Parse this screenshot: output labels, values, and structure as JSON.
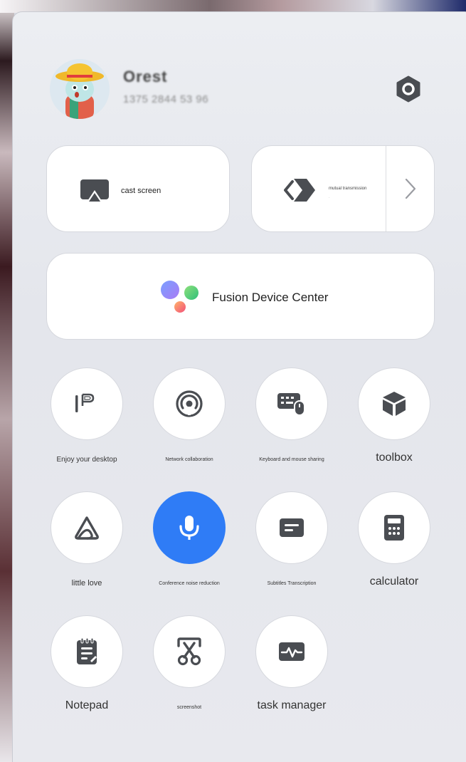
{
  "user": {
    "name": "Orest",
    "id": "1375 2844 53 96"
  },
  "cards": {
    "cast": {
      "label": "cast screen"
    },
    "mutual": {
      "label": "mutual transmission",
      "sub": "·"
    },
    "fusion": {
      "label": "Fusion Device Center"
    }
  },
  "tiles": [
    {
      "label": "Enjoy your desktop",
      "icon": "parallels-icon"
    },
    {
      "label": "Network collaboration",
      "icon": "broadcast-icon"
    },
    {
      "label": "Keyboard and mouse sharing",
      "icon": "keyboard-mouse-icon"
    },
    {
      "label": "toolbox",
      "icon": "cube-icon"
    },
    {
      "label": "little love",
      "icon": "little-love-icon"
    },
    {
      "label": "Conference noise reduction",
      "icon": "microphone-icon",
      "active": true
    },
    {
      "label": "Subtitles Transcription",
      "icon": "subtitles-icon"
    },
    {
      "label": "calculator",
      "icon": "calculator-icon"
    },
    {
      "label": "Notepad",
      "icon": "notepad-icon"
    },
    {
      "label": "screenshot",
      "icon": "scissors-icon"
    },
    {
      "label": "task manager",
      "icon": "pulse-monitor-icon"
    }
  ],
  "colors": {
    "accent": "#2f7cf6",
    "icon": "#4a4d52",
    "card": "#ffffff",
    "panel": "#e8e9ee"
  }
}
